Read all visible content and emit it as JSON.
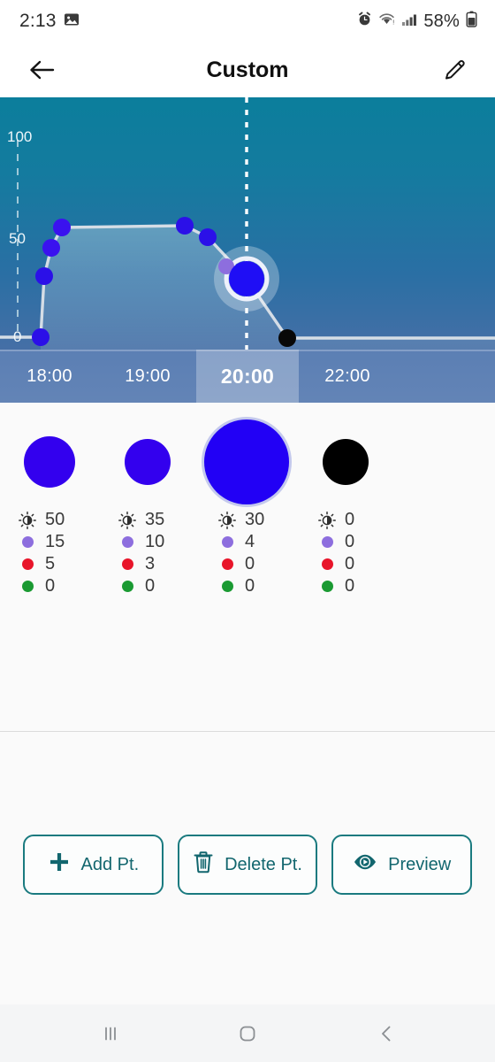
{
  "statusbar": {
    "time": "2:13",
    "battery_pct": "58%",
    "icons": [
      "image-icon",
      "alarm-icon",
      "wifi-icon",
      "signal-icon",
      "battery-icon"
    ]
  },
  "appbar": {
    "title": "Custom",
    "back_icon": "back-arrow-icon",
    "edit_icon": "pencil-edit-icon"
  },
  "chart_data": {
    "type": "line",
    "title": "Custom",
    "xlabel": "",
    "ylabel": "",
    "ylim": [
      0,
      100
    ],
    "yticks": [
      0,
      50,
      100
    ],
    "ytick_labels": [
      "0",
      "50",
      "100"
    ],
    "grid": false,
    "legend": "none",
    "axis_line_style": "dashed",
    "selected_index": 6,
    "cursor_time": "20:00",
    "series": [
      {
        "name": "brightness",
        "points": [
          {
            "time": "17:30",
            "value": 0,
            "color": "#2b10e8",
            "selected": false
          },
          {
            "time": "17:40",
            "value": 30,
            "color": "#2b10e8",
            "selected": false
          },
          {
            "time": "17:50",
            "value": 44,
            "color": "#3a12ef",
            "selected": false
          },
          {
            "time": "18:00",
            "value": 54,
            "color": "#3a12ef",
            "selected": false
          },
          {
            "time": "19:30",
            "value": 54,
            "color": "#2b10e8",
            "selected": false
          },
          {
            "time": "19:45",
            "value": 50,
            "color": "#2b10e8",
            "selected": false
          },
          {
            "time": "20:00",
            "value": 30,
            "color": "#1f0ef5",
            "selected": true
          },
          {
            "time": "20:30",
            "value": 0,
            "color": "#080808",
            "selected": false
          }
        ]
      }
    ],
    "ghost_point": {
      "time": "19:55",
      "value": 36,
      "color": "#8d6ede"
    },
    "area_fill": "rgba(255,255,255,0.22)",
    "line_color": "#d5dde6",
    "background_gradient": [
      "#0b7e9c",
      "#456fa6"
    ]
  },
  "timeline": {
    "labels": [
      "18:00",
      "19:00",
      "20:00",
      "22:00"
    ],
    "selected": "20:00",
    "selected_index": 2
  },
  "swatches": [
    {
      "color": "#3300ee",
      "size": 58,
      "selected": false
    },
    {
      "color": "#3300ee",
      "size": 52,
      "selected": false
    },
    {
      "color": "#2200f5",
      "size": 96,
      "selected": true
    },
    {
      "color": "#000000",
      "size": 52,
      "selected": false
    }
  ],
  "value_columns": [
    {
      "brightness": "50",
      "white": "15",
      "red": "5",
      "green": "0"
    },
    {
      "brightness": "35",
      "white": "10",
      "red": "3",
      "green": "0"
    },
    {
      "brightness": "30",
      "white": "4",
      "red": "0",
      "green": "0"
    },
    {
      "brightness": "0",
      "white": "0",
      "red": "0",
      "green": "0"
    }
  ],
  "value_colors": {
    "brightness_icon": "brightness-icon",
    "white": "#8d6ede",
    "red": "#e8152a",
    "green": "#1a9a32"
  },
  "actions": [
    {
      "label": "Add Pt.",
      "icon": "plus-icon"
    },
    {
      "label": "Delete Pt.",
      "icon": "trash-icon"
    },
    {
      "label": "Preview",
      "icon": "eye-play-icon"
    }
  ],
  "navbar": {
    "recents_icon": "recents-icon",
    "home_icon": "home-icon",
    "back_icon": "nav-back-icon"
  },
  "theme": {
    "accent": "#12666e",
    "chart_top": "#0b7e9c",
    "chart_bottom": "#456fa6",
    "timestrip": "#5b7fb4",
    "page_bg": "#fafafa"
  }
}
